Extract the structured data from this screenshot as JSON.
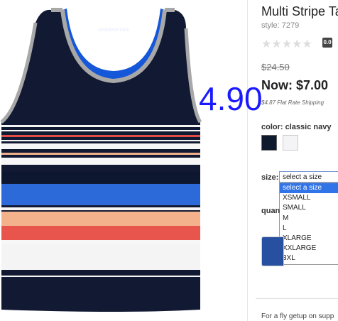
{
  "product": {
    "title": "Multi Stripe Ta",
    "style": "style: 7279",
    "rating_badge": "0.0",
    "stars_icon": "star-icon",
    "price_was": "$24.50",
    "price_now": "Now: $7.00",
    "shipping": "$4.87 Flat Rate Shipping",
    "color_label": "color: classic navy",
    "colors": [
      "#0f1a2e",
      "#f4f4f7"
    ],
    "size_label": "size:",
    "size_select_value": "select a size",
    "size_options": [
      "select a size",
      "XSMALL",
      "SMALL",
      "M",
      "L",
      "XLARGE",
      "XXLARGE",
      "3XL"
    ],
    "quantity_label": "quan",
    "description": "For a fly getup on supp"
  },
  "overlay_number": "4.90",
  "image": {
    "brand_text": "AEROPOSTALE"
  }
}
